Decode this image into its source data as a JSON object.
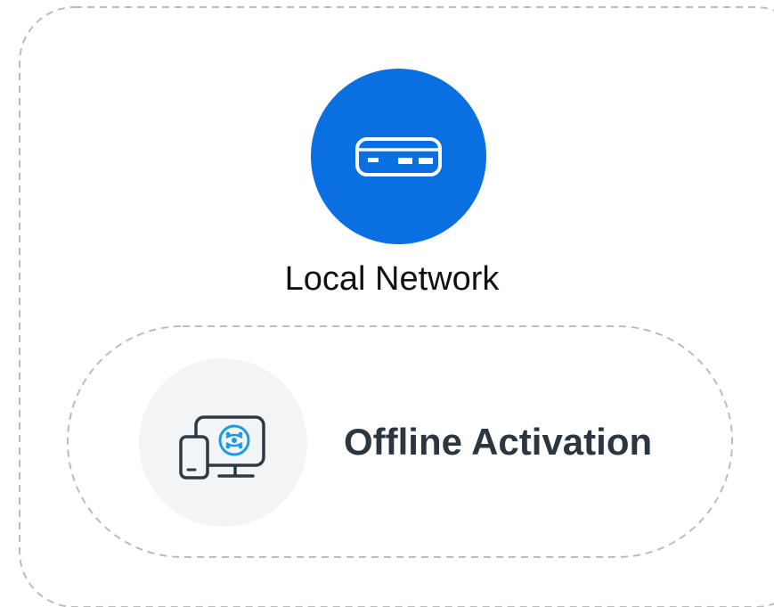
{
  "diagram": {
    "network": {
      "label": "Local Network",
      "icon": "router-icon",
      "circle_color": "#0a6fe0"
    },
    "activation": {
      "label": "Offline Activation",
      "icon": "devices-activation-icon",
      "circle_color": "#f3f4f6",
      "accent_color": "#1b9be0"
    },
    "frame_color": "#b9bcc0"
  }
}
